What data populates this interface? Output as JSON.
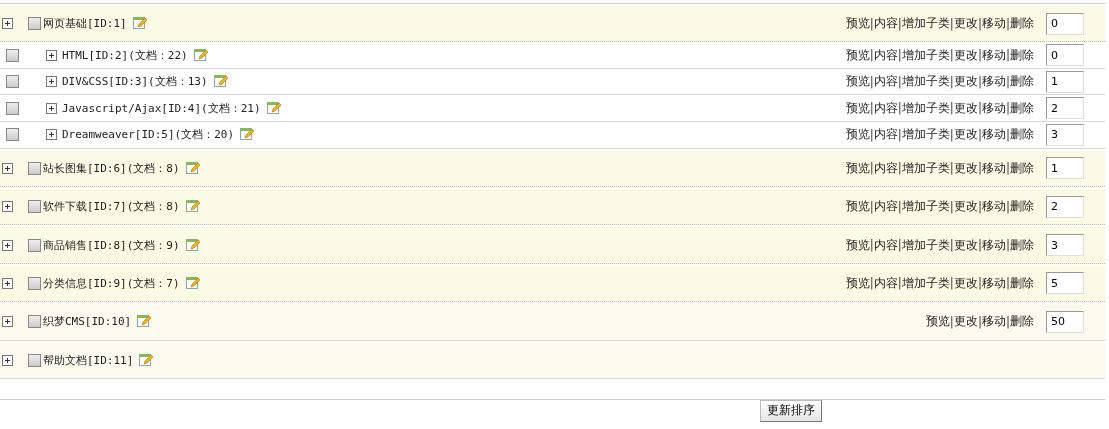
{
  "separator": "|",
  "categories": [
    {
      "label": "网页基础[ID:1]",
      "checked": false,
      "actions": [
        "预览",
        "内容",
        "增加子类",
        "更改",
        "移动",
        "删除"
      ],
      "order": "0",
      "children": [
        {
          "label": "HTML[ID:2](文档：22)",
          "checked": false,
          "actions": [
            "预览",
            "内容",
            "增加子类",
            "更改",
            "移动",
            "删除"
          ],
          "order": "0"
        },
        {
          "label": "DIV&CSS[ID:3](文档：13)",
          "checked": false,
          "actions": [
            "预览",
            "内容",
            "增加子类",
            "更改",
            "移动",
            "删除"
          ],
          "order": "1"
        },
        {
          "label": "Javascript/Ajax[ID:4](文档：21)",
          "checked": false,
          "actions": [
            "预览",
            "内容",
            "增加子类",
            "更改",
            "移动",
            "删除"
          ],
          "order": "2"
        },
        {
          "label": "Dreamweaver[ID:5](文档：20)",
          "checked": false,
          "actions": [
            "预览",
            "内容",
            "增加子类",
            "更改",
            "移动",
            "删除"
          ],
          "order": "3"
        }
      ]
    },
    {
      "label": "站长图集[ID:6](文档：8)",
      "checked": false,
      "actions": [
        "预览",
        "内容",
        "增加子类",
        "更改",
        "移动",
        "删除"
      ],
      "order": "1"
    },
    {
      "label": "软件下载[ID:7](文档：8)",
      "checked": false,
      "actions": [
        "预览",
        "内容",
        "增加子类",
        "更改",
        "移动",
        "删除"
      ],
      "order": "2"
    },
    {
      "label": "商品销售[ID:8](文档：9)",
      "checked": false,
      "actions": [
        "预览",
        "内容",
        "增加子类",
        "更改",
        "移动",
        "删除"
      ],
      "order": "3"
    },
    {
      "label": "分类信息[ID:9](文档：7)",
      "checked": false,
      "actions": [
        "预览",
        "内容",
        "增加子类",
        "更改",
        "移动",
        "删除"
      ],
      "order": "5"
    },
    {
      "label": "织梦CMS[ID:10]",
      "checked": false,
      "actions": [
        "预览",
        "更改",
        "移动",
        "删除"
      ],
      "order": "50",
      "kind": "light"
    },
    {
      "label": "帮助文档[ID:11]",
      "checked": false,
      "kind": "light"
    }
  ],
  "buttons": [
    "更新排序"
  ]
}
